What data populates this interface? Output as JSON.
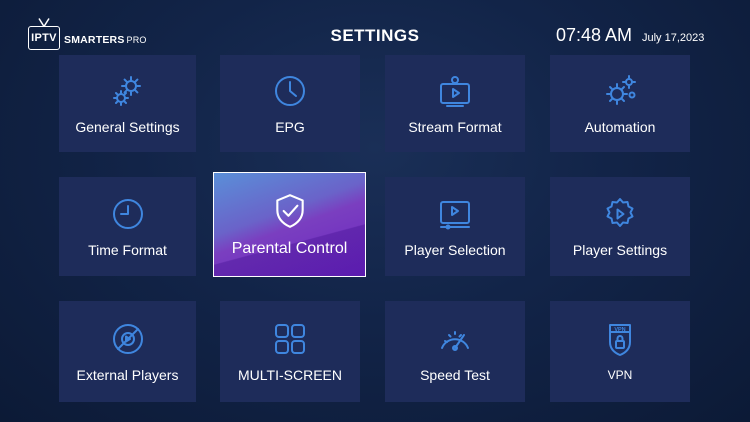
{
  "header": {
    "logo_iptv": "IPTV",
    "logo_smarters": "SMARTERS",
    "logo_pro": "PRO",
    "title": "SETTINGS",
    "time": "07:48 AM",
    "date": "July 17,2023"
  },
  "tiles": [
    {
      "label": "General Settings",
      "icon": "gears-icon"
    },
    {
      "label": "EPG",
      "icon": "clock-icon"
    },
    {
      "label": "Stream Format",
      "icon": "tv-play-icon"
    },
    {
      "label": "Automation",
      "icon": "automation-gears-icon"
    },
    {
      "label": "Time Format",
      "icon": "time-clock-icon"
    },
    {
      "label": "Parental Control",
      "icon": "shield-check-icon"
    },
    {
      "label": "Player Selection",
      "icon": "player-screen-icon"
    },
    {
      "label": "Player Settings",
      "icon": "gear-play-icon"
    },
    {
      "label": "External Players",
      "icon": "blocked-play-icon"
    },
    {
      "label": "MULTI-SCREEN",
      "icon": "grid-squares-icon"
    },
    {
      "label": "Speed Test",
      "icon": "speedometer-icon"
    },
    {
      "label": "VPN",
      "icon": "vpn-shield-icon",
      "icon_text": "VPN"
    }
  ],
  "colors": {
    "background": "#122448",
    "tile": "#1e2c5a",
    "icon": "#3f86df",
    "selected_start": "#5a8fd8",
    "selected_end": "#6b24c2"
  },
  "selected_tile": "Parental Control"
}
